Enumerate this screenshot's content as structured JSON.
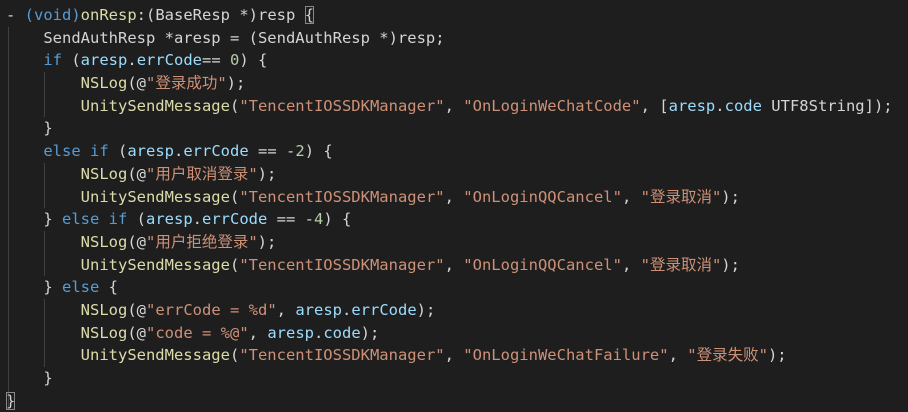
{
  "theme": {
    "background": "#1e1e1e",
    "keyword": "#569cd6",
    "function": "#dcdcaa",
    "string": "#ce9178",
    "variable": "#9cdcfe",
    "number": "#b5cea8",
    "plain": "#d4d4d4"
  },
  "lines": [
    [
      [
        "punct",
        "- "
      ],
      [
        "kw",
        "(void)"
      ],
      [
        "fn",
        "onResp"
      ],
      [
        "punct",
        ":("
      ],
      [
        "plain",
        "BaseResp *"
      ],
      [
        "punct",
        ")"
      ],
      [
        "plain",
        "resp "
      ],
      [
        "box",
        "{"
      ]
    ],
    [
      [
        "plain",
        "    SendAuthResp *aresp = (SendAuthResp *)resp;"
      ]
    ],
    [
      [
        "kw",
        "    if "
      ],
      [
        "punct",
        "("
      ],
      [
        "var",
        "aresp"
      ],
      [
        "punct",
        "."
      ],
      [
        "var",
        "errCode"
      ],
      [
        "punct",
        "== "
      ],
      [
        "num",
        "0"
      ],
      [
        "punct",
        ") {"
      ]
    ],
    [
      [
        "fn",
        "        NSLog"
      ],
      [
        "punct",
        "(@"
      ],
      [
        "str",
        "\"登录成功\""
      ],
      [
        "punct",
        ");"
      ]
    ],
    [
      [
        "fn",
        "        UnitySendMessage"
      ],
      [
        "punct",
        "("
      ],
      [
        "str",
        "\"TencentIOSSDKManager\""
      ],
      [
        "punct",
        ", "
      ],
      [
        "str",
        "\"OnLoginWeChatCode\""
      ],
      [
        "punct",
        ", ["
      ],
      [
        "var",
        "aresp"
      ],
      [
        "punct",
        "."
      ],
      [
        "var",
        "code"
      ],
      [
        "plain",
        " UTF8String"
      ],
      [
        "punct",
        "]);"
      ]
    ],
    [
      [
        "punct",
        "    }"
      ]
    ],
    [
      [
        "kw",
        "    else if "
      ],
      [
        "punct",
        "("
      ],
      [
        "var",
        "aresp"
      ],
      [
        "punct",
        "."
      ],
      [
        "var",
        "errCode"
      ],
      [
        "punct",
        " == -"
      ],
      [
        "num",
        "2"
      ],
      [
        "punct",
        ") {"
      ]
    ],
    [
      [
        "fn",
        "        NSLog"
      ],
      [
        "punct",
        "(@"
      ],
      [
        "str",
        "\"用户取消登录\""
      ],
      [
        "punct",
        ");"
      ]
    ],
    [
      [
        "fn",
        "        UnitySendMessage"
      ],
      [
        "punct",
        "("
      ],
      [
        "str",
        "\"TencentIOSSDKManager\""
      ],
      [
        "punct",
        ", "
      ],
      [
        "str",
        "\"OnLoginQQCancel\""
      ],
      [
        "punct",
        ", "
      ],
      [
        "str",
        "\"登录取消\""
      ],
      [
        "punct",
        ");"
      ]
    ],
    [
      [
        "punct",
        "    } "
      ],
      [
        "kw",
        "else if "
      ],
      [
        "punct",
        "("
      ],
      [
        "var",
        "aresp"
      ],
      [
        "punct",
        "."
      ],
      [
        "var",
        "errCode"
      ],
      [
        "punct",
        " == -"
      ],
      [
        "num",
        "4"
      ],
      [
        "punct",
        ") {"
      ]
    ],
    [
      [
        "fn",
        "        NSLog"
      ],
      [
        "punct",
        "(@"
      ],
      [
        "str",
        "\"用户拒绝登录\""
      ],
      [
        "punct",
        ");"
      ]
    ],
    [
      [
        "fn",
        "        UnitySendMessage"
      ],
      [
        "punct",
        "("
      ],
      [
        "str",
        "\"TencentIOSSDKManager\""
      ],
      [
        "punct",
        ", "
      ],
      [
        "str",
        "\"OnLoginQQCancel\""
      ],
      [
        "punct",
        ", "
      ],
      [
        "str",
        "\"登录取消\""
      ],
      [
        "punct",
        ");"
      ]
    ],
    [
      [
        "punct",
        "    } "
      ],
      [
        "kw",
        "else "
      ],
      [
        "punct",
        "{"
      ]
    ],
    [
      [
        "fn",
        "        NSLog"
      ],
      [
        "punct",
        "(@"
      ],
      [
        "str",
        "\"errCode = %d\""
      ],
      [
        "punct",
        ", "
      ],
      [
        "var",
        "aresp"
      ],
      [
        "punct",
        "."
      ],
      [
        "var",
        "errCode"
      ],
      [
        "punct",
        ");"
      ]
    ],
    [
      [
        "fn",
        "        NSLog"
      ],
      [
        "punct",
        "(@"
      ],
      [
        "str",
        "\"code = %@\""
      ],
      [
        "punct",
        ", "
      ],
      [
        "var",
        "aresp"
      ],
      [
        "punct",
        "."
      ],
      [
        "var",
        "code"
      ],
      [
        "punct",
        ");"
      ]
    ],
    [
      [
        "fn",
        "        UnitySendMessage"
      ],
      [
        "punct",
        "("
      ],
      [
        "str",
        "\"TencentIOSSDKManager\""
      ],
      [
        "punct",
        ", "
      ],
      [
        "str",
        "\"OnLoginWeChatFailure\""
      ],
      [
        "punct",
        ", "
      ],
      [
        "str",
        "\"登录失败\""
      ],
      [
        "punct",
        ");"
      ]
    ],
    [
      [
        "punct",
        "    }"
      ]
    ],
    [
      [
        "box",
        "}"
      ]
    ]
  ]
}
